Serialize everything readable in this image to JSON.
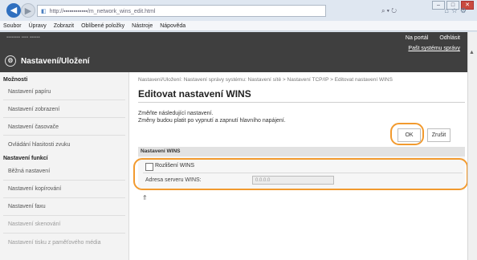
{
  "browser": {
    "url": "http://▪▪▪▪▪▪▪▪▪▪▪▪/m_network_wins_edit.html",
    "search_icon": "search-icon",
    "refresh_icon": "refresh-icon",
    "menu": [
      "Soubor",
      "Úpravy",
      "Zobrazit",
      "Oblíbené položky",
      "Nástroje",
      "Nápověda"
    ]
  },
  "header": {
    "model": "▪▪▪▪▪▪▪▪  ▪▪▪▪  ▪▪▪▪▪▪",
    "portal": "Na portál",
    "logout": "Odhlásit",
    "admin_password": "Pašt systému správy",
    "title": "Nastavení/Uložení",
    "accent": "#3f3f3f"
  },
  "sidebar": {
    "prefs_heading": "Možnosti",
    "prefs_items": [
      "Nastavení papíru",
      "Nastavení zobrazení",
      "Nastavení časovače",
      "Ovládání hlasitosti zvuku"
    ],
    "functions_heading": "Nastavení funkcí",
    "functions_items": [
      "Běžná nastavení",
      "Nastavení kopírování",
      "Nastavení faxu",
      "Nastavení skenování",
      "Nastavení tisku z paměťového média"
    ]
  },
  "main": {
    "breadcrumb": "Nastavení/Uložení: Nastavení správy systému: Nastavení sítě > Nastavení TCP/IP > Editovat nastavení WINS",
    "title": "Editovat nastavení WINS",
    "desc_line1": "Změňte následující nastavení.",
    "desc_line2": "Změny budou platit po vypnutí a zapnutí hlavního napájení.",
    "ok_label": "OK",
    "cancel_label": "Zrušit",
    "section_title": "Nastavení WINS",
    "wins_checkbox_label": "Rozlišení WINS",
    "wins_checked": false,
    "server_address_label": "Adresa serveru WINS:",
    "server_address_value": "0.0.0.0",
    "top_icon": "page-top-icon",
    "highlight_color": "#f29a2e"
  }
}
